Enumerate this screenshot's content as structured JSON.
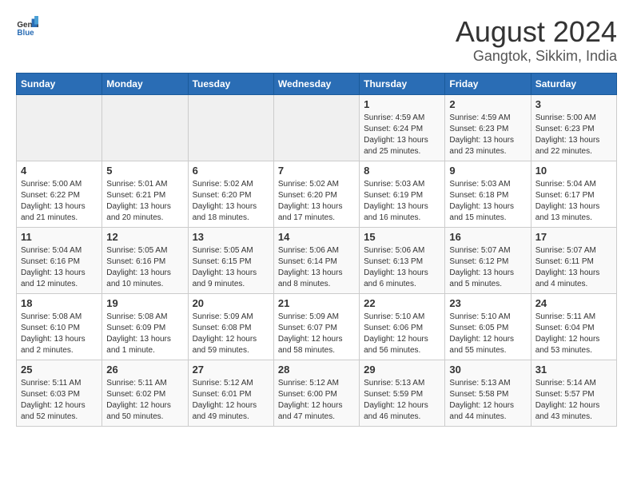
{
  "header": {
    "logo_general": "General",
    "logo_blue": "Blue",
    "title": "August 2024",
    "location": "Gangtok, Sikkim, India"
  },
  "calendar": {
    "days_of_week": [
      "Sunday",
      "Monday",
      "Tuesday",
      "Wednesday",
      "Thursday",
      "Friday",
      "Saturday"
    ],
    "weeks": [
      [
        {
          "day": "",
          "detail": ""
        },
        {
          "day": "",
          "detail": ""
        },
        {
          "day": "",
          "detail": ""
        },
        {
          "day": "",
          "detail": ""
        },
        {
          "day": "1",
          "detail": "Sunrise: 4:59 AM\nSunset: 6:24 PM\nDaylight: 13 hours\nand 25 minutes."
        },
        {
          "day": "2",
          "detail": "Sunrise: 4:59 AM\nSunset: 6:23 PM\nDaylight: 13 hours\nand 23 minutes."
        },
        {
          "day": "3",
          "detail": "Sunrise: 5:00 AM\nSunset: 6:23 PM\nDaylight: 13 hours\nand 22 minutes."
        }
      ],
      [
        {
          "day": "4",
          "detail": "Sunrise: 5:00 AM\nSunset: 6:22 PM\nDaylight: 13 hours\nand 21 minutes."
        },
        {
          "day": "5",
          "detail": "Sunrise: 5:01 AM\nSunset: 6:21 PM\nDaylight: 13 hours\nand 20 minutes."
        },
        {
          "day": "6",
          "detail": "Sunrise: 5:02 AM\nSunset: 6:20 PM\nDaylight: 13 hours\nand 18 minutes."
        },
        {
          "day": "7",
          "detail": "Sunrise: 5:02 AM\nSunset: 6:20 PM\nDaylight: 13 hours\nand 17 minutes."
        },
        {
          "day": "8",
          "detail": "Sunrise: 5:03 AM\nSunset: 6:19 PM\nDaylight: 13 hours\nand 16 minutes."
        },
        {
          "day": "9",
          "detail": "Sunrise: 5:03 AM\nSunset: 6:18 PM\nDaylight: 13 hours\nand 15 minutes."
        },
        {
          "day": "10",
          "detail": "Sunrise: 5:04 AM\nSunset: 6:17 PM\nDaylight: 13 hours\nand 13 minutes."
        }
      ],
      [
        {
          "day": "11",
          "detail": "Sunrise: 5:04 AM\nSunset: 6:16 PM\nDaylight: 13 hours\nand 12 minutes."
        },
        {
          "day": "12",
          "detail": "Sunrise: 5:05 AM\nSunset: 6:16 PM\nDaylight: 13 hours\nand 10 minutes."
        },
        {
          "day": "13",
          "detail": "Sunrise: 5:05 AM\nSunset: 6:15 PM\nDaylight: 13 hours\nand 9 minutes."
        },
        {
          "day": "14",
          "detail": "Sunrise: 5:06 AM\nSunset: 6:14 PM\nDaylight: 13 hours\nand 8 minutes."
        },
        {
          "day": "15",
          "detail": "Sunrise: 5:06 AM\nSunset: 6:13 PM\nDaylight: 13 hours\nand 6 minutes."
        },
        {
          "day": "16",
          "detail": "Sunrise: 5:07 AM\nSunset: 6:12 PM\nDaylight: 13 hours\nand 5 minutes."
        },
        {
          "day": "17",
          "detail": "Sunrise: 5:07 AM\nSunset: 6:11 PM\nDaylight: 13 hours\nand 4 minutes."
        }
      ],
      [
        {
          "day": "18",
          "detail": "Sunrise: 5:08 AM\nSunset: 6:10 PM\nDaylight: 13 hours\nand 2 minutes."
        },
        {
          "day": "19",
          "detail": "Sunrise: 5:08 AM\nSunset: 6:09 PM\nDaylight: 13 hours\nand 1 minute."
        },
        {
          "day": "20",
          "detail": "Sunrise: 5:09 AM\nSunset: 6:08 PM\nDaylight: 12 hours\nand 59 minutes."
        },
        {
          "day": "21",
          "detail": "Sunrise: 5:09 AM\nSunset: 6:07 PM\nDaylight: 12 hours\nand 58 minutes."
        },
        {
          "day": "22",
          "detail": "Sunrise: 5:10 AM\nSunset: 6:06 PM\nDaylight: 12 hours\nand 56 minutes."
        },
        {
          "day": "23",
          "detail": "Sunrise: 5:10 AM\nSunset: 6:05 PM\nDaylight: 12 hours\nand 55 minutes."
        },
        {
          "day": "24",
          "detail": "Sunrise: 5:11 AM\nSunset: 6:04 PM\nDaylight: 12 hours\nand 53 minutes."
        }
      ],
      [
        {
          "day": "25",
          "detail": "Sunrise: 5:11 AM\nSunset: 6:03 PM\nDaylight: 12 hours\nand 52 minutes."
        },
        {
          "day": "26",
          "detail": "Sunrise: 5:11 AM\nSunset: 6:02 PM\nDaylight: 12 hours\nand 50 minutes."
        },
        {
          "day": "27",
          "detail": "Sunrise: 5:12 AM\nSunset: 6:01 PM\nDaylight: 12 hours\nand 49 minutes."
        },
        {
          "day": "28",
          "detail": "Sunrise: 5:12 AM\nSunset: 6:00 PM\nDaylight: 12 hours\nand 47 minutes."
        },
        {
          "day": "29",
          "detail": "Sunrise: 5:13 AM\nSunset: 5:59 PM\nDaylight: 12 hours\nand 46 minutes."
        },
        {
          "day": "30",
          "detail": "Sunrise: 5:13 AM\nSunset: 5:58 PM\nDaylight: 12 hours\nand 44 minutes."
        },
        {
          "day": "31",
          "detail": "Sunrise: 5:14 AM\nSunset: 5:57 PM\nDaylight: 12 hours\nand 43 minutes."
        }
      ]
    ]
  }
}
